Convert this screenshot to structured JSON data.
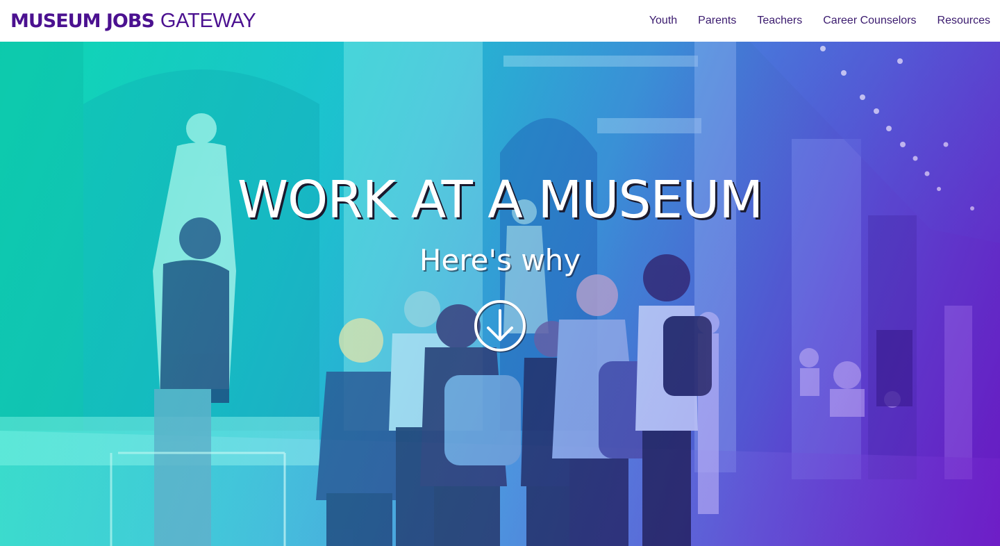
{
  "header": {
    "logo": {
      "bold": "MUSEUM JOBS",
      "light": "GATEWAY"
    },
    "nav": [
      {
        "label": "Youth"
      },
      {
        "label": "Parents"
      },
      {
        "label": "Teachers"
      },
      {
        "label": "Career Counselors"
      },
      {
        "label": "Resources"
      }
    ]
  },
  "hero": {
    "title": "WORK AT A MUSEUM",
    "subtitle": "Here's why",
    "scroll_icon": "arrow-down-circle-icon",
    "background_image": "museum-gallery-tour-photo"
  },
  "colors": {
    "brand_purple": "#4b1190",
    "gradient_start": "#12d9b6",
    "gradient_end": "#6a1fc8",
    "hero_text": "#ffffff"
  }
}
